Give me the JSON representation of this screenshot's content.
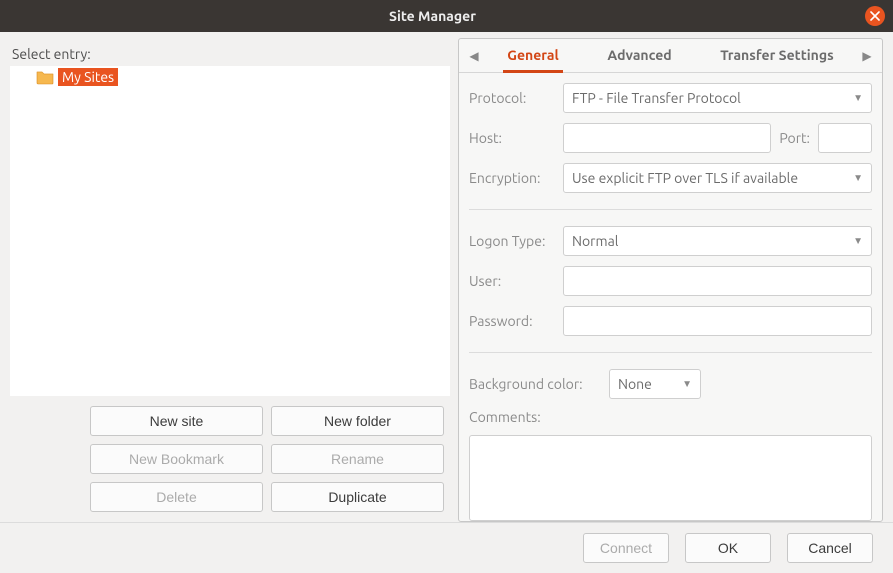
{
  "window": {
    "title": "Site Manager"
  },
  "left": {
    "select_entry_label": "Select entry:",
    "tree": {
      "root_label": "My Sites"
    },
    "buttons": {
      "new_site": "New site",
      "new_folder": "New folder",
      "new_bookmark": "New Bookmark",
      "rename": "Rename",
      "delete": "Delete",
      "duplicate": "Duplicate"
    }
  },
  "tabs": {
    "general": "General",
    "advanced": "Advanced",
    "transfer": "Transfer Settings"
  },
  "form": {
    "protocol_label": "Protocol:",
    "protocol_value": "FTP - File Transfer Protocol",
    "host_label": "Host:",
    "host_value": "",
    "port_label": "Port:",
    "port_value": "",
    "encryption_label": "Encryption:",
    "encryption_value": "Use explicit FTP over TLS if available",
    "logon_type_label": "Logon Type:",
    "logon_type_value": "Normal",
    "user_label": "User:",
    "user_value": "",
    "password_label": "Password:",
    "password_value": "",
    "bgcolor_label": "Background color:",
    "bgcolor_value": "None",
    "comments_label": "Comments:",
    "comments_value": ""
  },
  "footer": {
    "connect": "Connect",
    "ok": "OK",
    "cancel": "Cancel"
  }
}
